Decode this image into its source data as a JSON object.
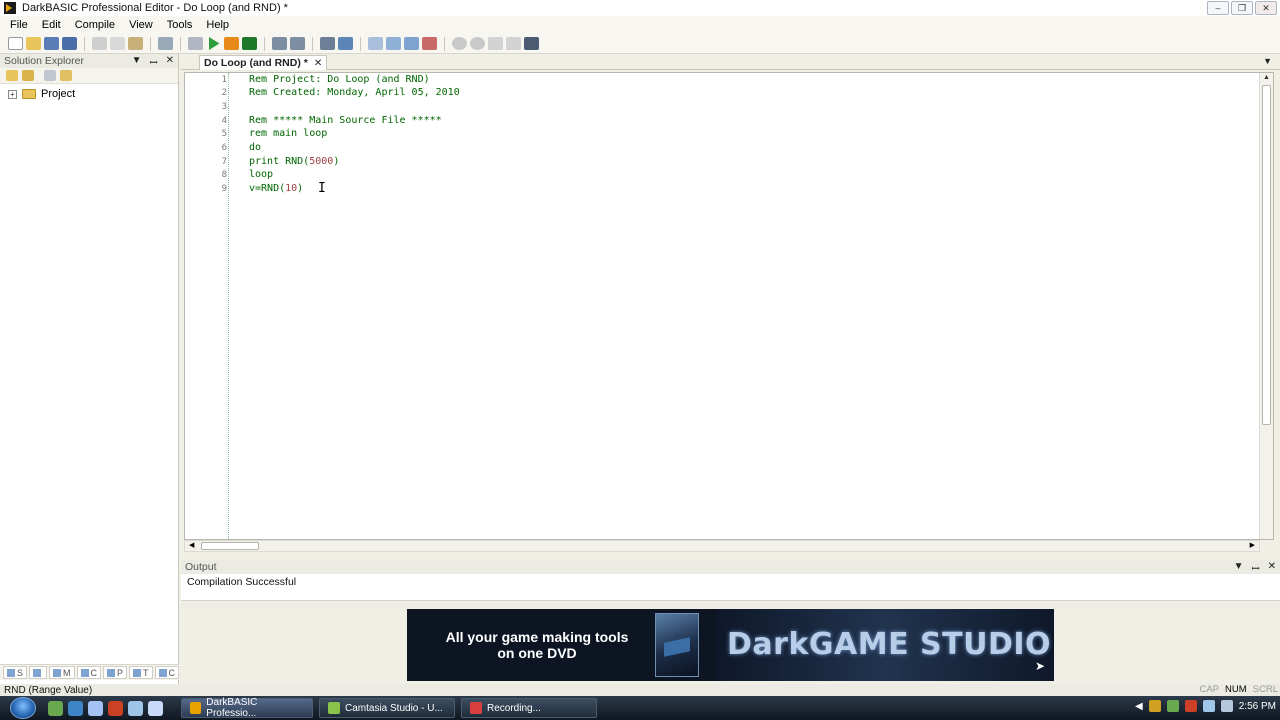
{
  "window": {
    "title": "DarkBASIC Professional Editor - Do Loop (and RND) *",
    "minimize_label": "–",
    "restore_label": "❐",
    "close_label": "✕"
  },
  "menu": {
    "items": [
      "File",
      "Edit",
      "Compile",
      "View",
      "Tools",
      "Help"
    ]
  },
  "solution_explorer": {
    "title": "Solution Explorer",
    "pin_label": "▼",
    "autohide_label": "ꟷ",
    "close_label": "✕",
    "tree_root": "Project",
    "expander": "+",
    "bottom_tabs": [
      "S",
      "",
      "M",
      "C",
      "P",
      "T",
      "C"
    ]
  },
  "document": {
    "tab_label": "Do Loop (and RND) *",
    "tab_close": "✕",
    "dropdown": "▼"
  },
  "editor": {
    "line_numbers": [
      "1",
      "2",
      "3",
      "4",
      "5",
      "6",
      "7",
      "8",
      "9"
    ],
    "lines": [
      "Rem Project: Do Loop (and RND)",
      "Rem Created: Monday, April 05, 2010",
      "",
      "Rem ***** Main Source File *****",
      "rem main loop",
      "do",
      "print RND(5000)",
      "loop",
      "v=RND(10)"
    ]
  },
  "output": {
    "title": "Output",
    "message": "Compilation Successful"
  },
  "banner": {
    "left_text_1": "All your game making tools",
    "left_text_2": "on one DVD",
    "right_text": "DarkGAME STUDIO"
  },
  "status": {
    "text": "RND (Range Value)",
    "indicators": [
      {
        "label": "CAP",
        "on": false
      },
      {
        "label": "NUM",
        "on": true
      },
      {
        "label": "SCRL",
        "on": false
      }
    ]
  },
  "taskbar": {
    "buttons": [
      {
        "label": "DarkBASIC Professio...",
        "active": true,
        "color": "#e8a200"
      },
      {
        "label": "Camtasia Studio - U...",
        "active": false,
        "color": "#8bc34a"
      },
      {
        "label": "Recording...",
        "active": false,
        "color": "#d84040"
      }
    ],
    "clock": "2:56 PM"
  }
}
